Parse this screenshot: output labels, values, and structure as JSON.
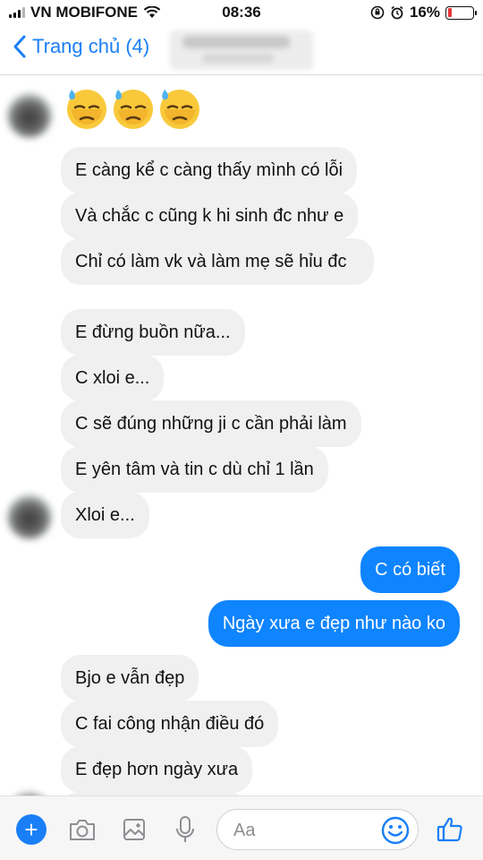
{
  "status": {
    "carrier": "VN MOBIFONE",
    "time": "08:36",
    "battery": "16%",
    "battery_level": 0.16
  },
  "header": {
    "back_label": "Trang chủ (4)"
  },
  "messages": [
    {
      "text": "E càng kể c càng thấy mình có lỗi"
    },
    {
      "text": "Và chắc c cũng k hi sinh đc như e"
    },
    {
      "text": "Chỉ có làm vk và làm mẹ sẽ hỉu đc"
    },
    {
      "text": "E đừng buồn nữa..."
    },
    {
      "text": "C xloi e..."
    },
    {
      "text": "C sẽ đúng những ji c cần phải làm"
    },
    {
      "text": "E yên tâm và tin c dù chỉ 1 lần"
    },
    {
      "text": "Xloi e..."
    },
    {
      "text": "C có biết"
    },
    {
      "text": "Ngày xưa e đẹp như nào ko"
    },
    {
      "text": "Bjo e vẫn đẹp"
    },
    {
      "text": "C fai công nhận điều đó"
    },
    {
      "text": "E đẹp hơn ngày xưa"
    }
  ],
  "emojis": [
    "downcast-sweat-emoji",
    "downcast-sweat-emoji",
    "downcast-sweat-emoji"
  ],
  "composer": {
    "placeholder": "Aa",
    "icons": [
      "plus-icon",
      "camera-icon",
      "image-icon",
      "microphone-icon",
      "smiley-icon",
      "thumbs-up-icon"
    ]
  },
  "colors": {
    "accent": "#1a7ff6",
    "outgoing_bubble": "#0f84ff",
    "incoming_bubble": "#f1f0f0"
  }
}
